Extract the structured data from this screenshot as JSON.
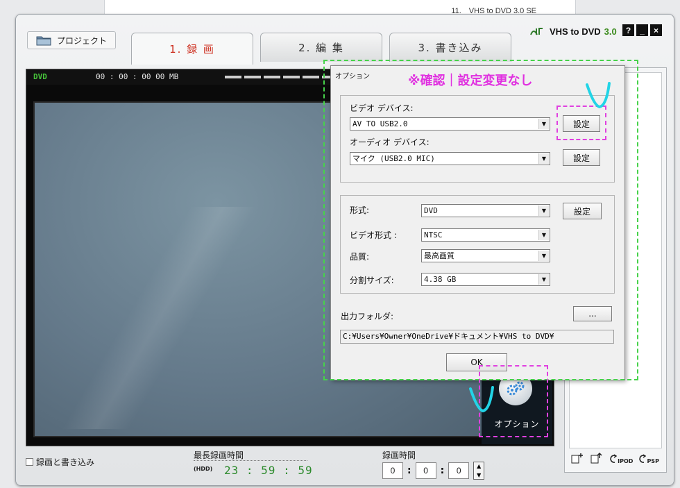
{
  "background_window": {
    "title": "11.　VHS to DVD 3.0 SE"
  },
  "app": {
    "project_button": "プロジェクト",
    "tabs": [
      {
        "label": "1. 録 画",
        "active": true
      },
      {
        "label": "2. 編 集",
        "active": false
      },
      {
        "label": "3. 書き込み",
        "active": false
      }
    ],
    "brand": {
      "name": "VHS to DVD",
      "version": "3.0"
    },
    "window_buttons": [
      "?",
      "_",
      "×"
    ],
    "status_bar": {
      "format": "DVD",
      "timecode": "00 : 00 : 00  00 MB"
    },
    "option_button_label": "オプション",
    "bottom": {
      "record_and_write": "録画と書き込み",
      "max_record_time_label": "最長録画時間",
      "hdd_label": "(HDD)",
      "max_record_time": "23 : 59 : 59",
      "record_time_label": "録画時間",
      "record_time": [
        "0",
        "0",
        "0"
      ]
    },
    "right_icons": [
      "IPOD",
      "PSP"
    ]
  },
  "dialog": {
    "title": "オプション",
    "video_device_label": "ビデオ デバイス:",
    "video_device_value": "AV TO USB2.0",
    "audio_device_label": "オーディオ デバイス:",
    "audio_device_value": "マイク (USB2.0 MIC)",
    "settings_label": "設定",
    "format_label": "形式:",
    "format_value": "DVD",
    "video_format_label": "ビデオ形式 :",
    "video_format_value": "NTSC",
    "quality_label": "品質:",
    "quality_value": "最高画質",
    "split_size_label": "分割サイズ:",
    "split_size_value": "4.38 GB",
    "output_folder_label": "出力フォルダ:",
    "browse_label": "...",
    "output_folder_value": "C:¥Users¥Owner¥OneDrive¥ドキュメント¥VHS to DVD¥",
    "ok_label": "OK"
  },
  "annotation": {
    "text": "※確認｜設定変更なし",
    "colors": {
      "magenta": "#e040e0",
      "green": "#46d24a",
      "cyan": "#22d4e6"
    }
  }
}
